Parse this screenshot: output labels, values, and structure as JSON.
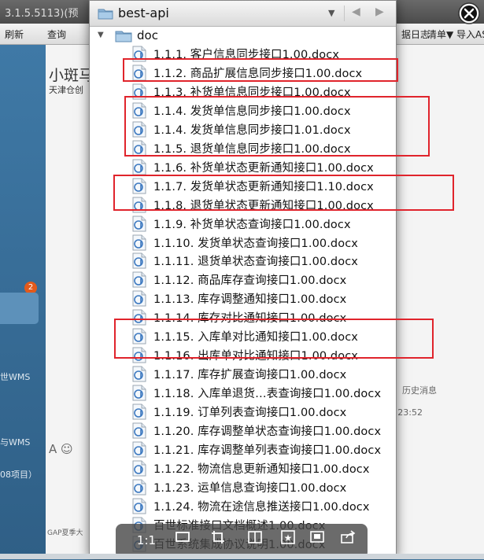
{
  "background": {
    "title": "3.1.5.5113)(预",
    "toolbar": [
      "刷新",
      "查询",
      "据日志",
      "清单▼",
      "导入AS"
    ],
    "left_labels": [
      "世WMS",
      "与WMS",
      "08项目）"
    ],
    "badge": "2",
    "contact_name": "小斑马",
    "contact_sub": "天津仓创",
    "history": "历史消息",
    "time": "23:52",
    "gap_text": "GAP夏季大",
    "composer_icons": "A ☺"
  },
  "popup": {
    "folder_name": "best-api",
    "root_label": "doc",
    "files": [
      "1.1.1. 客户信息同步接口1.00.docx",
      "1.1.2. 商品扩展信息同步接口1.00.docx",
      "1.1.3. 补货单信息同步接口1.00.docx",
      "1.1.4. 发货单信息同步接口1.00.docx",
      "1.1.4. 发货单信息同步接口1.01.docx",
      "1.1.5. 退货单信息同步接口1.00.docx",
      "1.1.6. 补货单状态更新通知接口1.00.docx",
      "1.1.7. 发货单状态更新通知接口1.10.docx",
      "1.1.8. 退货单状态更新通知接口1.00.docx",
      "1.1.9. 补货单状态查询接口1.00.docx",
      "1.1.10. 发货单状态查询接口1.00.docx",
      "1.1.11. 退货单状态查询接口1.00.docx",
      "1.1.12. 商品库存查询接口1.00.docx",
      "1.1.13. 库存调整通知接口1.00.docx",
      "1.1.14. 库存对比通知接口1.00.docx",
      "1.1.15. 入库单对比通知接口1.00.docx",
      "1.1.16. 出库单对比通知接口1.00.docx",
      "1.1.17. 库存扩展查询接口1.00.docx",
      "1.1.18. 入库单退货…表查询接口1.00.docx",
      "1.1.19. 订单列表查询接口1.00.docx",
      "1.1.20. 库存调整单状态查询接口1.00.docx",
      "1.1.21. 库存调整单列表查询接口1.00.docx",
      "1.1.22. 物流信息更新通知接口1.00.docx",
      "1.1.23. 运单信息查询接口1.00.docx",
      "1.1.24. 物流在途信息推送接口1.00.docx",
      "百世标准接口文档概述1.00.docx",
      "百世系统集成协议说明1.00.docx"
    ],
    "toolbar": {
      "zoom": "1:1"
    }
  },
  "colors": {
    "highlight": "#e0242c",
    "background_blue": "#3a6f98"
  }
}
